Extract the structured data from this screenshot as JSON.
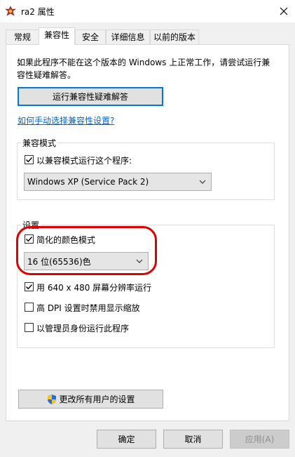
{
  "window": {
    "title": "ra2 属性"
  },
  "tabs": [
    {
      "label": "常规"
    },
    {
      "label": "兼容性"
    },
    {
      "label": "安全"
    },
    {
      "label": "详细信息"
    },
    {
      "label": "以前的版本"
    }
  ],
  "compat": {
    "intro_line1": "如果此程序不能在这个版本的 Windows 上正常工作，请尝试运行兼",
    "intro_line2": "容性疑难解答。",
    "troubleshoot_button": "运行兼容性疑难解答",
    "manual_link": "如何手动选择兼容性设置?",
    "mode_group": {
      "title": "兼容模式",
      "checkbox_label": "以兼容模式运行这个程序:",
      "checked": true,
      "os_select_value": "Windows XP (Service Pack 2)"
    },
    "settings_group": {
      "title": "设置",
      "reduced_color": {
        "label": "简化的颜色模式",
        "checked": true
      },
      "color_select_value": "16 位(65536)色",
      "run_640": {
        "label": "用 640 x 480 屏幕分辨率运行",
        "checked": true
      },
      "high_dpi": {
        "label": "高 DPI 设置时禁用显示缩放",
        "checked": false
      },
      "run_admin": {
        "label": "以管理员身份运行此程序",
        "checked": false
      }
    },
    "all_users_button": "更改所有用户的设置"
  },
  "buttons": {
    "ok": "确定",
    "cancel": "取消",
    "apply": "应用(A)"
  },
  "colors": {
    "accent": "#0078d7",
    "highlight_outline": "#e00000",
    "link": "#0066cc"
  }
}
